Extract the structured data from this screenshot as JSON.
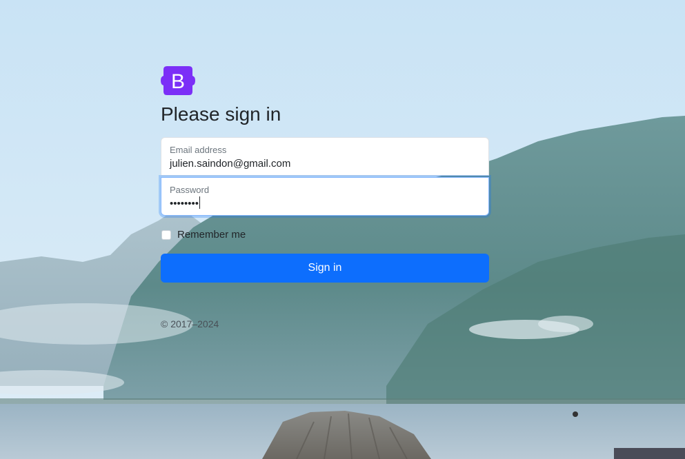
{
  "form": {
    "heading": "Please sign in",
    "email": {
      "label": "Email address",
      "value": "julien.saindon@gmail.com"
    },
    "password": {
      "label": "Password",
      "value": "••••••••"
    },
    "remember_label": "Remember me",
    "submit_label": "Sign in",
    "copyright": "© 2017–2024"
  },
  "logo": {
    "letter": "B",
    "icon": "bootstrap-logo-icon",
    "color": "#7b2ff7"
  },
  "colors": {
    "primary": "#0d6efd",
    "focus_border": "#86b7fe"
  }
}
